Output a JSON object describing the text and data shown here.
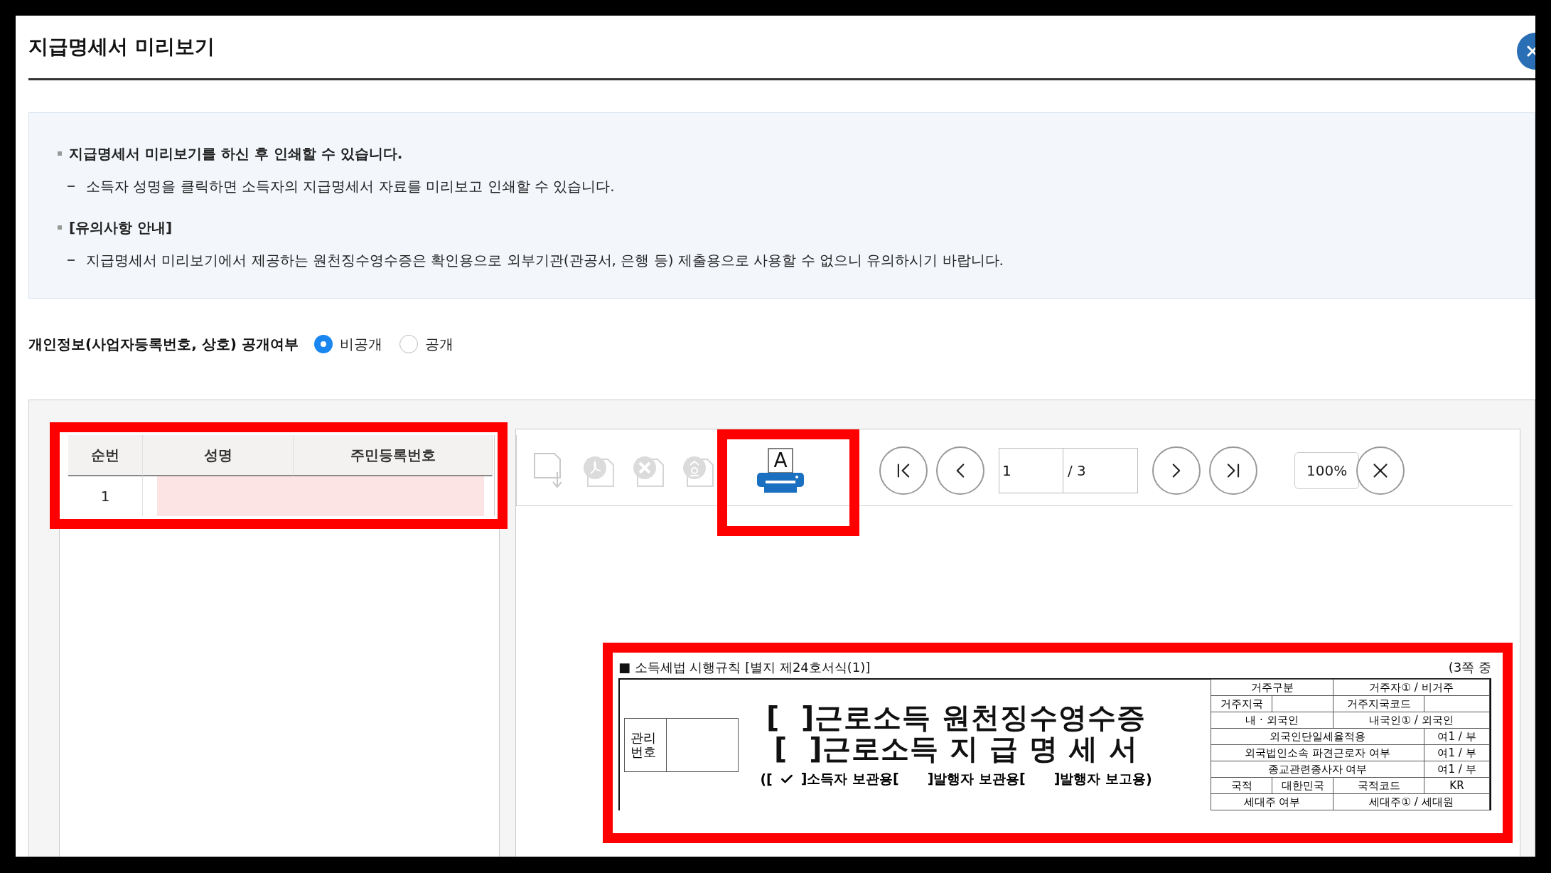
{
  "window": {
    "title": "지급명세서 미리보기"
  },
  "notice": [
    {
      "kind": "heading",
      "text": "지급명세서 미리보기를 하신 후 인쇄할 수 있습니다."
    },
    {
      "kind": "detail",
      "text": "소득자 성명을 클릭하면 소득자의 지급명세서 자료를 미리보고 인쇄할 수 있습니다."
    },
    {
      "kind": "heading",
      "text": "[유의사항 안내]"
    },
    {
      "kind": "detail",
      "text": "지급명세서 미리보기에서 제공하는 원천징수영수증은 확인용으로 외부기관(관공서, 은행 등) 제출용으로 사용할 수 없으니 유의하시기 바랍니다."
    }
  ],
  "privacy": {
    "label": "개인정보(사업자등록번호, 상호) 공개여부",
    "options": [
      {
        "label": "비공개",
        "selected": true
      },
      {
        "label": "공개",
        "selected": false
      }
    ]
  },
  "table": {
    "highlighted": true,
    "columns": [
      "순번",
      "성명",
      "주민등록번호"
    ],
    "rows": [
      {
        "no": "1",
        "selected": true
      }
    ]
  },
  "toolbar": {
    "tools": [
      {
        "kind": "save",
        "disabled": true
      },
      {
        "kind": "pdf",
        "disabled": true
      },
      {
        "kind": "excel",
        "disabled": true
      },
      {
        "kind": "hwp",
        "disabled": true
      },
      {
        "kind": "print",
        "disabled": false,
        "highlighted": true,
        "label": "A"
      }
    ],
    "page": "1",
    "total": "/ 3",
    "zoom": "100%"
  },
  "document": {
    "highlighted": true,
    "form_ref": "■ 소득세법 시행규칙 [별지 제24호서식(1)]",
    "page_note": "(3쪽 중",
    "mgmt_label": "관리번호",
    "titles": [
      "[  ]근로소득 원천징수영수증",
      "[  ]근로소득 지 급 명 세 서"
    ],
    "copies_open": "([",
    "copies_close": ")",
    "copies": [
      {
        "label": "]소득자 보관용[",
        "checked": true
      },
      {
        "label": "]발행자 보관용[",
        "checked": false
      },
      {
        "label": "]발행자 보고용",
        "checked": false
      }
    ],
    "info_rows": [
      {
        "kind": "pair",
        "cells": [
          {
            "text": "거주구분"
          },
          {
            "text": "거주자① / 비거주"
          }
        ]
      },
      {
        "kind": "quad",
        "cells": [
          {
            "text": "거주지국"
          },
          {},
          {
            "text": "거주지국코드"
          },
          {}
        ]
      },
      {
        "kind": "pair",
        "cells": [
          {
            "text": "내 · 외국인"
          },
          {
            "text": "내국인① / 외국인"
          }
        ]
      },
      {
        "kind": "flag",
        "cells": [
          {
            "text": "외국인단일세율적용"
          },
          {
            "text": "여1 / 부"
          }
        ]
      },
      {
        "kind": "flag",
        "cells": [
          {
            "text": "외국법인소속 파견근로자 여부"
          },
          {
            "text": "여1 / 부"
          }
        ]
      },
      {
        "kind": "flag",
        "cells": [
          {
            "text": "종교관련종사자 여부"
          },
          {
            "text": "여1 / 부"
          }
        ]
      },
      {
        "kind": "quad",
        "cells": [
          {
            "text": "국적"
          },
          {
            "text": "대한민국"
          },
          {
            "text": "국적코드"
          },
          {
            "text": "KR"
          }
        ]
      },
      {
        "kind": "pair",
        "cells": [
          {
            "text": "세대주 여부"
          },
          {
            "text": "세대주① / 세대원"
          }
        ]
      }
    ]
  }
}
